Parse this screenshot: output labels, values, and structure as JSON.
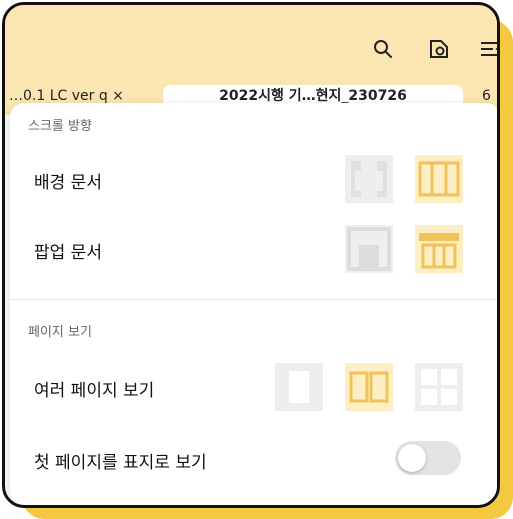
{
  "toolbar": {
    "icons": [
      "search-icon",
      "settings-icon",
      "menu-icon"
    ]
  },
  "tabs": {
    "left": "…0.1 LC ver q  ×",
    "active": "2022시행 기…현지_230726",
    "right": "6"
  },
  "popup": {
    "scroll_section_title": "스크롤 방향",
    "background_doc_label": "배경 문서",
    "popup_doc_label": "팝업 문서",
    "page_view_section_title": "페이지 보기",
    "multi_page_label": "여러 페이지 보기",
    "cover_page_label": "첫 페이지를 표지로 보기",
    "cover_page_toggle": false
  },
  "colors": {
    "accent": "#f5c842",
    "toolbar_bg": "#fbe6b3",
    "selected_bg": "#fdeec4",
    "unselected_bg": "#eeeeee"
  }
}
